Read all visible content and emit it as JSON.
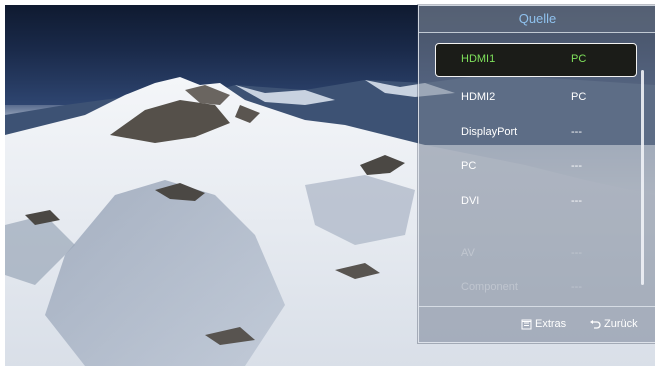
{
  "panel": {
    "title": "Quelle"
  },
  "sources": [
    {
      "name": "HDMI1",
      "value": "PC",
      "state": "selected"
    },
    {
      "name": "HDMI2",
      "value": "PC",
      "state": "normal"
    },
    {
      "name": "DisplayPort",
      "value": "---",
      "state": "normal"
    },
    {
      "name": "PC",
      "value": "---",
      "state": "normal"
    },
    {
      "name": "DVI",
      "value": "---",
      "state": "normal"
    },
    {
      "name": "AV",
      "value": "---",
      "state": "disabled"
    },
    {
      "name": "Component",
      "value": "---",
      "state": "disabled"
    }
  ],
  "footer": {
    "extras_label": "Extras",
    "back_label": "Zurück",
    "extras_icon": "tools-icon",
    "back_icon": "return-arrow-icon"
  },
  "colors": {
    "selected_text": "#7ee05b",
    "title_text": "#8fc1ee",
    "normal_text": "#ffffff"
  },
  "background": "snowy-mountain-photo"
}
